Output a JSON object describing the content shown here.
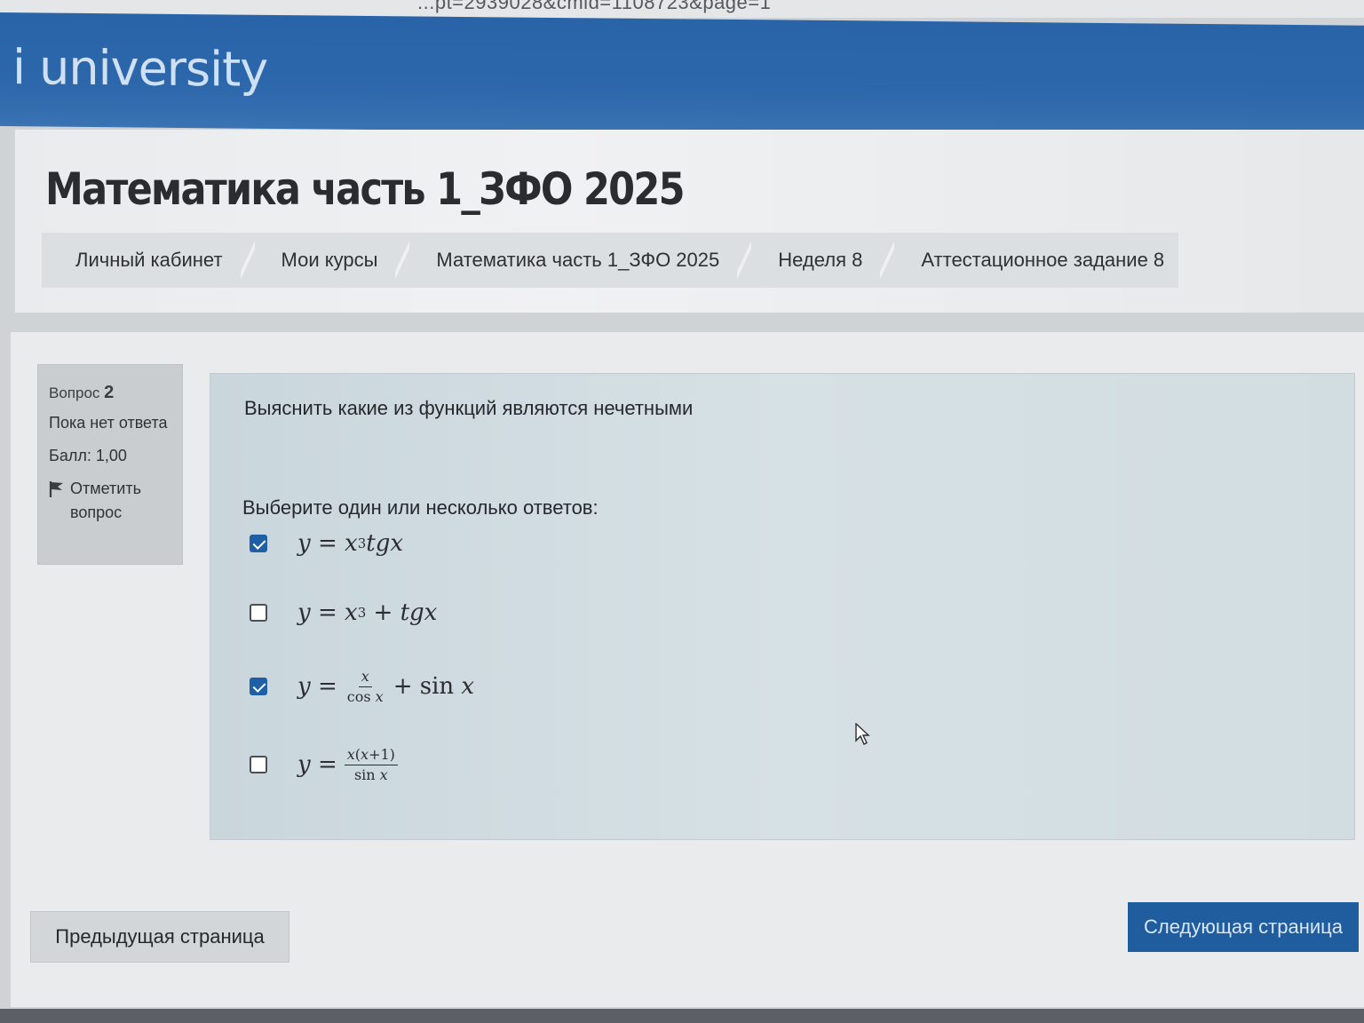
{
  "browser": {
    "url_fragment": "...pt=2939028&cmid=1108723&page=1"
  },
  "navbar": {
    "logo_text": "i university"
  },
  "header": {
    "course_title": "Математика часть 1_ЗФО 2025",
    "breadcrumb": [
      "Личный кабинет",
      "Мои курсы",
      "Математика часть 1_ЗФО 2025",
      "Неделя 8",
      "Аттестационное задание 8"
    ]
  },
  "info": {
    "question_label": "Вопрос",
    "question_number": "2",
    "status": "Пока нет ответа",
    "score": "Балл: 1,00",
    "flag_label": "Отметить вопрос"
  },
  "question": {
    "text": "Выяснить какие из функций являются нечетными",
    "prompt": "Выберите один или несколько ответов:",
    "options": [
      {
        "checked": true,
        "formula": "y = x³tgx"
      },
      {
        "checked": false,
        "formula": "y = x³ + tgx"
      },
      {
        "checked": true,
        "formula": "y = x/cos x + sin x"
      },
      {
        "checked": false,
        "formula": "y = x(x+1)/sin x"
      }
    ]
  },
  "nav": {
    "prev_label": "Предыдущая страница",
    "next_label": "Следующая страница"
  },
  "colors": {
    "navbar": "#2c67ab",
    "checkbox_checked": "#1f5fa6",
    "next_button": "#1f5d9f"
  }
}
